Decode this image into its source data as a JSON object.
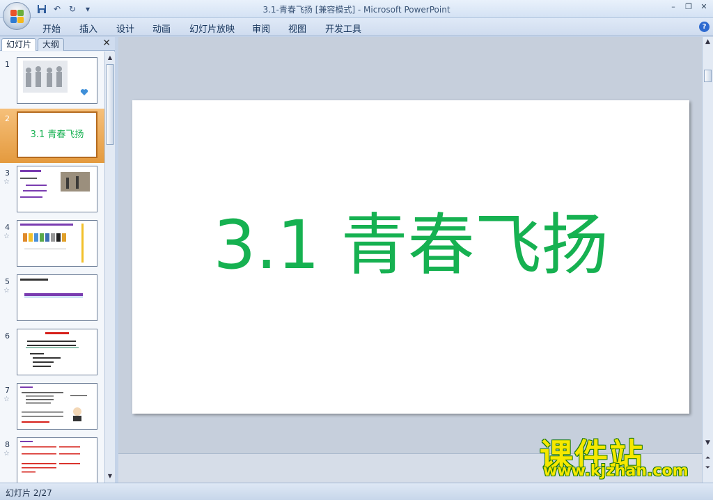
{
  "window": {
    "title": "3.1-青春飞扬 [兼容模式] - Microsoft PowerPoint",
    "controls": {
      "minimize": "–",
      "restore": "❐",
      "close": "✕"
    }
  },
  "quick_access": {
    "save_icon": "save-icon",
    "undo_icon": "undo-icon",
    "redo_icon": "redo-icon",
    "customize": "▾"
  },
  "ribbon_tabs": [
    "开始",
    "插入",
    "设计",
    "动画",
    "幻灯片放映",
    "审阅",
    "视图",
    "开发工具"
  ],
  "help_label": "?",
  "panel": {
    "tabs": [
      "幻灯片",
      "大纲"
    ],
    "close": "✕"
  },
  "thumbnails": [
    {
      "num": "1",
      "has_star": false
    },
    {
      "num": "2",
      "has_star": false,
      "title": "3.1 青春飞扬"
    },
    {
      "num": "3",
      "has_star": true
    },
    {
      "num": "4",
      "has_star": true
    },
    {
      "num": "5",
      "has_star": true
    },
    {
      "num": "6",
      "has_star": false
    },
    {
      "num": "7",
      "has_star": true
    },
    {
      "num": "8",
      "has_star": true
    }
  ],
  "slide": {
    "title": "3.1 青春飞扬",
    "title_color": "#16b151"
  },
  "status": {
    "slide_counter": "幻灯片 2/27"
  },
  "watermark": {
    "name": "课件站",
    "url": "www.kjzhan.com"
  }
}
